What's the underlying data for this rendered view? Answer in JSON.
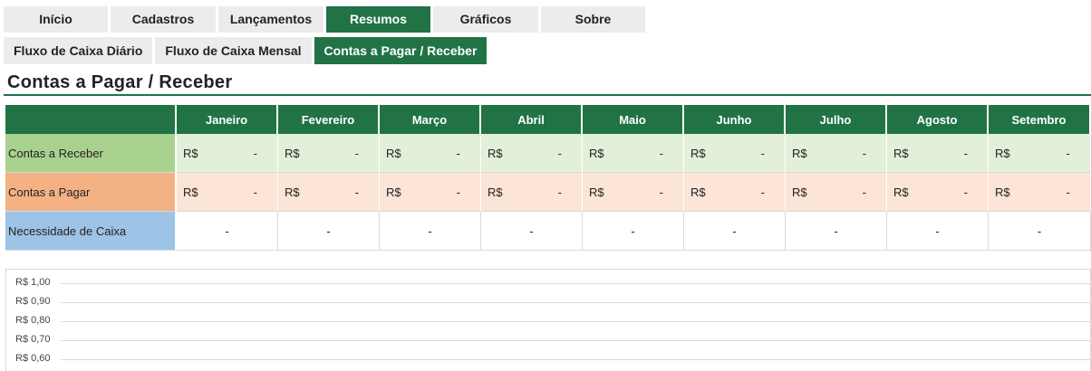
{
  "nav": {
    "tabs": [
      {
        "label": "Início",
        "active": false
      },
      {
        "label": "Cadastros",
        "active": false
      },
      {
        "label": "Lançamentos",
        "active": false
      },
      {
        "label": "Resumos",
        "active": true
      },
      {
        "label": "Gráficos",
        "active": false
      },
      {
        "label": "Sobre",
        "active": false
      }
    ],
    "subtabs": [
      {
        "label": "Fluxo de Caixa Diário",
        "active": false
      },
      {
        "label": "Fluxo de Caixa Mensal",
        "active": false
      },
      {
        "label": "Contas a Pagar / Receber",
        "active": true
      }
    ]
  },
  "page": {
    "title": "Contas a Pagar / Receber"
  },
  "table": {
    "months": [
      "Janeiro",
      "Fevereiro",
      "Março",
      "Abril",
      "Maio",
      "Junho",
      "Julho",
      "Agosto",
      "Setembro"
    ],
    "rows": [
      {
        "label": "Contas a Receber",
        "currency": "R$",
        "value": "-"
      },
      {
        "label": "Contas a Pagar",
        "currency": "R$",
        "value": "-"
      },
      {
        "label": "Necessidade de Caixa",
        "currency": "",
        "value": "-"
      }
    ]
  },
  "colors": {
    "accent": "#217346",
    "receber_label": "#a9d18e",
    "receber_cells": "#e2f0d9",
    "pagar_label": "#f4b183",
    "pagar_cells": "#fce4d6",
    "caixa_label": "#9dc3e6"
  },
  "chart": {
    "y_ticks": [
      "R$ 1,00",
      "R$ 0,90",
      "R$ 0,80",
      "R$ 0,70",
      "R$ 0,60"
    ]
  }
}
